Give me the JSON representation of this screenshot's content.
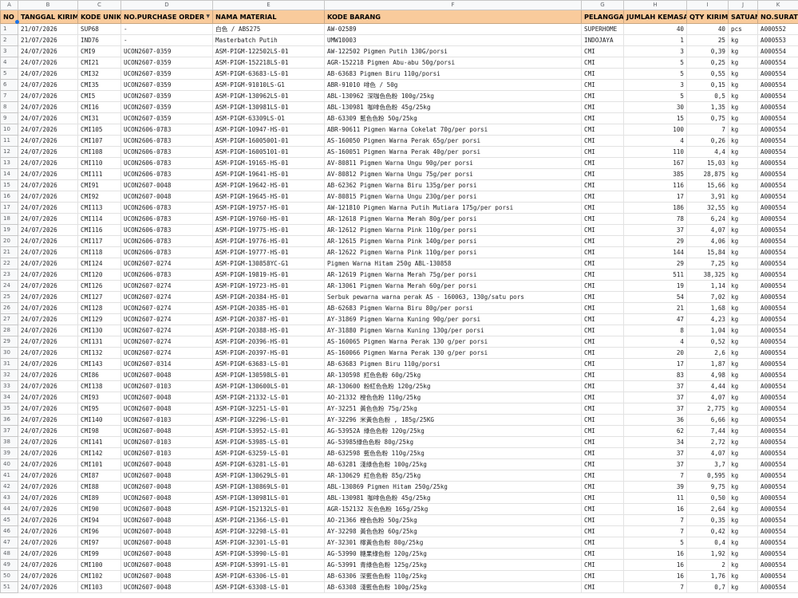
{
  "columns": [
    "A",
    "B",
    "C",
    "D",
    "E",
    "F",
    "G",
    "H",
    "I",
    "J",
    "K"
  ],
  "headers": [
    "NO",
    "TANGGAL KIRIM",
    "KODE UNIK",
    "NO.PURCHASE ORDER",
    "NAMA MATERIAL",
    "KODE BARANG",
    "PELANGGAN",
    "JUMLAH KEMASAN",
    "QTY KIRIM",
    "SATUAN",
    "NO.SURAT"
  ],
  "rows": [
    [
      "1",
      "21/07/2026",
      "SUP68",
      "-",
      "白色 / ABS275",
      "AW-02589",
      "SUPERHOME",
      "40",
      "40",
      "pcs",
      "A000552"
    ],
    [
      "2",
      "21/07/2026",
      "IND76",
      "-",
      "Masterbatch Putih",
      "UMW10003",
      "INDOJAYA",
      "1",
      "25",
      "kg",
      "A000553"
    ],
    [
      "3",
      "24/07/2026",
      "CMI9",
      "UCON2607-0359",
      "ASM-PIGM-122502LS-01",
      "AW-122502 Pigmen Putih 130G/porsi",
      "CMI",
      "3",
      "0,39",
      "kg",
      "A000554"
    ],
    [
      "4",
      "24/07/2026",
      "CMI21",
      "UCON2607-0359",
      "ASM-PIGM-152218LS-01",
      "AGR-152218 Pigmen Abu-abu 50g/porsi",
      "CMI",
      "5",
      "0,25",
      "kg",
      "A000554"
    ],
    [
      "5",
      "24/07/2026",
      "CMI32",
      "UCON2607-0359",
      "ASM-PIGM-63683-LS-01",
      "AB-63683 Pigmen Biru 110g/porsi",
      "CMI",
      "5",
      "0,55",
      "kg",
      "A000554"
    ],
    [
      "6",
      "24/07/2026",
      "CMI35",
      "UCON2607-0359",
      "ASM-PIGM-91010LS-G1",
      "ABR-91010 啡色 / 50g",
      "CMI",
      "3",
      "0,15",
      "kg",
      "A000554"
    ],
    [
      "7",
      "24/07/2026",
      "CMI5",
      "UCON2607-0359",
      "ASM-PIGM-130962LS-01",
      "ABL-130962 深咖色色粉 100g/25kg",
      "CMI",
      "5",
      "0,5",
      "kg",
      "A000554"
    ],
    [
      "8",
      "24/07/2026",
      "CMI16",
      "UCON2607-0359",
      "ASM-PIGM-130981LS-01",
      "ABL-130981 咖啡色色粉 45g/25kg",
      "CMI",
      "30",
      "1,35",
      "kg",
      "A000554"
    ],
    [
      "9",
      "24/07/2026",
      "CMI31",
      "UCON2607-0359",
      "ASM-PIGM-63309LS-01",
      "AB-63309 藍色色粉 50g/25kg",
      "CMI",
      "15",
      "0,75",
      "kg",
      "A000554"
    ],
    [
      "10",
      "24/07/2026",
      "CMI105",
      "UCON2606-0783",
      "ASM-PIGM-10947-HS-01",
      "ABR-90611 Pigmen Warna Cokelat 70g/per porsi",
      "CMI",
      "100",
      "7",
      "kg",
      "A000554"
    ],
    [
      "11",
      "24/07/2026",
      "CMI107",
      "UCON2606-0783",
      "ASM-PIGM-16005001-01",
      "AS-160050 Pigmen Warna Perak 65g/per porsi",
      "CMI",
      "4",
      "0,26",
      "kg",
      "A000554"
    ],
    [
      "12",
      "24/07/2026",
      "CMI108",
      "UCON2606-0783",
      "ASM-PIGM-16005101-01",
      "AS-160051 Pigmen Warna Perak 40g/per porsi",
      "CMI",
      "110",
      "4,4",
      "kg",
      "A000554"
    ],
    [
      "13",
      "24/07/2026",
      "CMI110",
      "UCON2606-0783",
      "ASM-PIGM-19165-HS-01",
      "AV-80811 Pigmen Warna Ungu 90g/per porsi",
      "CMI",
      "167",
      "15,03",
      "kg",
      "A000554"
    ],
    [
      "14",
      "24/07/2026",
      "CMI111",
      "UCON2606-0783",
      "ASM-PIGM-19641-HS-01",
      "AV-80812 Pigmen Warna Ungu 75g/per porsi",
      "CMI",
      "385",
      "28,875",
      "kg",
      "A000554"
    ],
    [
      "15",
      "24/07/2026",
      "CMI91",
      "UCON2607-0048",
      "ASM-PIGM-19642-HS-01",
      "AB-62362 Pigmen Warna Biru 135g/per porsi",
      "CMI",
      "116",
      "15,66",
      "kg",
      "A000554"
    ],
    [
      "16",
      "24/07/2026",
      "CMI92",
      "UCON2607-0048",
      "ASM-PIGM-19645-HS-01",
      "AV-80815 Pigmen Warna Ungu 230g/per porsi",
      "CMI",
      "17",
      "3,91",
      "kg",
      "A000554"
    ],
    [
      "17",
      "24/07/2026",
      "CMI113",
      "UCON2606-0783",
      "ASM-PIGM-19757-HS-01",
      "AW-121810 Pigmen Warna Putih Mutiara 175g/per porsi",
      "CMI",
      "186",
      "32,55",
      "kg",
      "A000554"
    ],
    [
      "18",
      "24/07/2026",
      "CMI114",
      "UCON2606-0783",
      "ASM-PIGM-19760-HS-01",
      "AR-12618 Pigmen Warna Merah 80g/per porsi",
      "CMI",
      "78",
      "6,24",
      "kg",
      "A000554"
    ],
    [
      "19",
      "24/07/2026",
      "CMI116",
      "UCON2606-0783",
      "ASM-PIGM-19775-HS-01",
      "AR-12612 Pigmen Warna Pink 110g/per porsi",
      "CMI",
      "37",
      "4,07",
      "kg",
      "A000554"
    ],
    [
      "20",
      "24/07/2026",
      "CMI117",
      "UCON2606-0783",
      "ASM-PIGM-19776-HS-01",
      "AR-12615 Pigmen Warna Pink 140g/per porsi",
      "CMI",
      "29",
      "4,06",
      "kg",
      "A000554"
    ],
    [
      "21",
      "24/07/2026",
      "CMI118",
      "UCON2606-0783",
      "ASM-PIGM-19777-HS-01",
      "AR-12622 Pigmen Warna Pink 110g/per porsi",
      "CMI",
      "144",
      "15,84",
      "kg",
      "A000554"
    ],
    [
      "22",
      "24/07/2026",
      "CMI124",
      "UCON2607-0274",
      "ASM-PIGM-130858YC-G1",
      "Pigmen Warna Hitam 250g ABL-130858",
      "CMI",
      "29",
      "7,25",
      "kg",
      "A000554"
    ],
    [
      "23",
      "24/07/2026",
      "CMI120",
      "UCON2606-0783",
      "ASM-PIGM-19819-HS-01",
      "AR-12619 Pigmen Warna Merah 75g/per porsi",
      "CMI",
      "511",
      "38,325",
      "kg",
      "A000554"
    ],
    [
      "24",
      "24/07/2026",
      "CMI126",
      "UCON2607-0274",
      "ASM-PIGM-19723-HS-01",
      "AR-13061 Pigmen Warna Merah 60g/per porsi",
      "CMI",
      "19",
      "1,14",
      "kg",
      "A000554"
    ],
    [
      "25",
      "24/07/2026",
      "CMI127",
      "UCON2607-0274",
      "ASM-PIGM-20384-HS-01",
      "Serbuk pewarna warna perak AS - 160063, 130g/satu pors",
      "CMI",
      "54",
      "7,02",
      "kg",
      "A000554"
    ],
    [
      "26",
      "24/07/2026",
      "CMI128",
      "UCON2607-0274",
      "ASM-PIGM-20385-HS-01",
      "AB-62683 Pigmen Warna Biru 80g/per porsi",
      "CMI",
      "21",
      "1,68",
      "kg",
      "A000554"
    ],
    [
      "27",
      "24/07/2026",
      "CMI129",
      "UCON2607-0274",
      "ASM-PIGM-20387-HS-01",
      "AY-31869 Pigmen Warna Kuning 90g/per porsi",
      "CMI",
      "47",
      "4,23",
      "kg",
      "A000554"
    ],
    [
      "28",
      "24/07/2026",
      "CMI130",
      "UCON2607-0274",
      "ASM-PIGM-20388-HS-01",
      "AY-31880 Pigmen Warna Kuning 130g/per porsi",
      "CMI",
      "8",
      "1,04",
      "kg",
      "A000554"
    ],
    [
      "29",
      "24/07/2026",
      "CMI131",
      "UCON2607-0274",
      "ASM-PIGM-20396-HS-01",
      "AS-160065 Pigmen Warna Perak 130 g/per porsi",
      "CMI",
      "4",
      "0,52",
      "kg",
      "A000554"
    ],
    [
      "30",
      "24/07/2026",
      "CMI132",
      "UCON2607-0274",
      "ASM-PIGM-20397-HS-01",
      "AS-160066 Pigmen Warna Perak 130 g/per porsi",
      "CMI",
      "20",
      "2,6",
      "kg",
      "A000554"
    ],
    [
      "31",
      "24/07/2026",
      "CMI143",
      "UCON2607-0314",
      "ASM-PIGM-63683-LS-01",
      "AB-63683 Pigmen Biru 110g/porsi",
      "CMI",
      "17",
      "1,87",
      "kg",
      "A000554"
    ],
    [
      "32",
      "24/07/2026",
      "CMI86",
      "UCON2607-0048",
      "ASM-PIGM-130598LS-01",
      "AR-130598 紅色色粉 60g/25kg",
      "CMI",
      "83",
      "4,98",
      "kg",
      "A000554"
    ],
    [
      "33",
      "24/07/2026",
      "CMI138",
      "UCON2607-0103",
      "ASM-PIGM-130600LS-01",
      "AR-130600 粉紅色色粉 120g/25kg",
      "CMI",
      "37",
      "4,44",
      "kg",
      "A000554"
    ],
    [
      "34",
      "24/07/2026",
      "CMI93",
      "UCON2607-0048",
      "ASM-PIGM-21332-LS-01",
      "AO-21332 橙色色粉 110g/25kg",
      "CMI",
      "37",
      "4,07",
      "kg",
      "A000554"
    ],
    [
      "35",
      "24/07/2026",
      "CMI95",
      "UCON2607-0048",
      "ASM-PIGM-32251-LS-01",
      "AY-32251 黃色色粉 75g/25kg",
      "CMI",
      "37",
      "2,775",
      "kg",
      "A000554"
    ],
    [
      "36",
      "24/07/2026",
      "CMI140",
      "UCON2607-0103",
      "ASM-PIGM-32296-LS-01",
      "AY-32296 米黃色色粉 , 185g/25KG",
      "CMI",
      "36",
      "6,66",
      "kg",
      "A000554"
    ],
    [
      "37",
      "24/07/2026",
      "CMI98",
      "UCON2607-0048",
      "ASM-PIGM-53952-LS-01",
      "AG-53952A 綠色色粉 120g/25kg",
      "CMI",
      "62",
      "7,44",
      "kg",
      "A000554"
    ],
    [
      "38",
      "24/07/2026",
      "CMI141",
      "UCON2607-0103",
      "ASM-PIGM-53985-LS-01",
      "AG-53985綠色色粉 80g/25kg",
      "CMI",
      "34",
      "2,72",
      "kg",
      "A000554"
    ],
    [
      "39",
      "24/07/2026",
      "CMI142",
      "UCON2607-0103",
      "ASM-PIGM-63259-LS-01",
      "AB-632598 藍色色粉 110g/25kg",
      "CMI",
      "37",
      "4,07",
      "kg",
      "A000554"
    ],
    [
      "40",
      "24/07/2026",
      "CMI101",
      "UCON2607-0048",
      "ASM-PIGM-63281-LS-01",
      "AB-63281 淺綠色色粉 100g/25kg",
      "CMI",
      "37",
      "3,7",
      "kg",
      "A000554"
    ],
    [
      "41",
      "24/07/2026",
      "CMI87",
      "UCON2607-0048",
      "ASM-PIGM-130629LS-01",
      "AR-130629 紅色色粉 85g/25kg",
      "CMI",
      "7",
      "0,595",
      "kg",
      "A000554"
    ],
    [
      "42",
      "24/07/2026",
      "CMI88",
      "UCON2607-0048",
      "ASM-PIGM-130869LS-01",
      "ABL-130869 Pigmen Hitam 250g/25kg",
      "CMI",
      "39",
      "9,75",
      "kg",
      "A000554"
    ],
    [
      "43",
      "24/07/2026",
      "CMI89",
      "UCON2607-0048",
      "ASM-PIGM-130981LS-01",
      "ABL-130981 咖啡色色粉 45g/25kg",
      "CMI",
      "11",
      "0,50",
      "kg",
      "A000554"
    ],
    [
      "44",
      "24/07/2026",
      "CMI90",
      "UCON2607-0048",
      "ASM-PIGM-152132LS-01",
      "AGR-152132 灰色色粉 165g/25kg",
      "CMI",
      "16",
      "2,64",
      "kg",
      "A000554"
    ],
    [
      "45",
      "24/07/2026",
      "CMI94",
      "UCON2607-0048",
      "ASM-PIGM-21366-LS-01",
      "AO-21366 橙色色粉 50g/25kg",
      "CMI",
      "7",
      "0,35",
      "kg",
      "A000554"
    ],
    [
      "46",
      "24/07/2026",
      "CMI96",
      "UCON2607-0048",
      "ASM-PIGM-32298-LS-01",
      "AY-32298 黃色色粉 60g/25kg",
      "CMI",
      "7",
      "0,42",
      "kg",
      "A000554"
    ],
    [
      "47",
      "24/07/2026",
      "CMI97",
      "UCON2607-0048",
      "ASM-PIGM-32301-LS-01",
      "AY-32301 檸黃色色粉 80g/25kg",
      "CMI",
      "5",
      "0,4",
      "kg",
      "A000554"
    ],
    [
      "48",
      "24/07/2026",
      "CMI99",
      "UCON2607-0048",
      "ASM-PIGM-53990-LS-01",
      "AG-53990 糖果綠色粉 120g/25kg",
      "CMI",
      "16",
      "1,92",
      "kg",
      "A000554"
    ],
    [
      "49",
      "24/07/2026",
      "CMI100",
      "UCON2607-0048",
      "ASM-PIGM-53991-LS-01",
      "AG-53991 青綠色色粉 125g/25kg",
      "CMI",
      "16",
      "2",
      "kg",
      "A000554"
    ],
    [
      "50",
      "24/07/2026",
      "CMI102",
      "UCON2607-0048",
      "ASM-PIGM-63306-LS-01",
      "AB-63306 深藍色色粉 110g/25kg",
      "CMI",
      "16",
      "1,76",
      "kg",
      "A000554"
    ],
    [
      "51",
      "24/07/2026",
      "CMI103",
      "UCON2607-0048",
      "ASM-PIGM-63308-LS-01",
      "AB-63308 淺藍色色粉 100g/25kg",
      "CMI",
      "7",
      "0,7",
      "kg",
      "A000554"
    ]
  ],
  "colors": {
    "header_bg": "#f9cb9c",
    "selection": "#1a73e8"
  },
  "icons": {
    "filter_dropdown": "dropdown-arrow-icon"
  }
}
